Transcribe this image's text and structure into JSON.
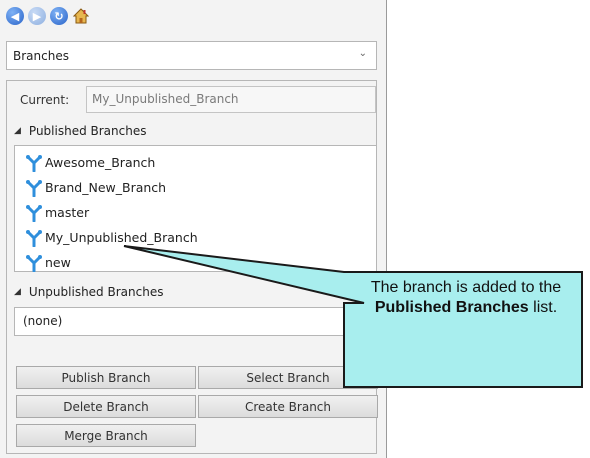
{
  "nav": {
    "back": "◀",
    "forward": "▶",
    "refresh": "↻"
  },
  "dropdown": {
    "value": "Branches"
  },
  "current": {
    "label": "Current:",
    "value": "My_Unpublished_Branch"
  },
  "published": {
    "header": "Published Branches",
    "items": [
      {
        "label": "Awesome_Branch"
      },
      {
        "label": "Brand_New_Branch"
      },
      {
        "label": "master"
      },
      {
        "label": "My_Unpublished_Branch"
      },
      {
        "label": "new"
      }
    ]
  },
  "unpublished": {
    "header": "Unpublished Branches",
    "value": "(none)"
  },
  "buttons": {
    "publish": "Publish Branch",
    "select": "Select Branch",
    "delete": "Delete Branch",
    "create": "Create Branch",
    "merge": "Merge Branch"
  },
  "callout": {
    "pre": "The branch is added to the",
    "bold": "Published Branches",
    "post": "list."
  },
  "colors": {
    "callout_fill": "#a8eeee",
    "callout_border": "#1a1a1a",
    "branch_icon": "#2f8fdc"
  },
  "icons": {
    "back": "arrow-left-icon",
    "forward": "arrow-right-icon",
    "refresh": "refresh-icon",
    "home": "home-icon",
    "branch": "branch-icon",
    "collapse": "triangle-down-icon",
    "dropdown": "chevron-down-icon"
  }
}
